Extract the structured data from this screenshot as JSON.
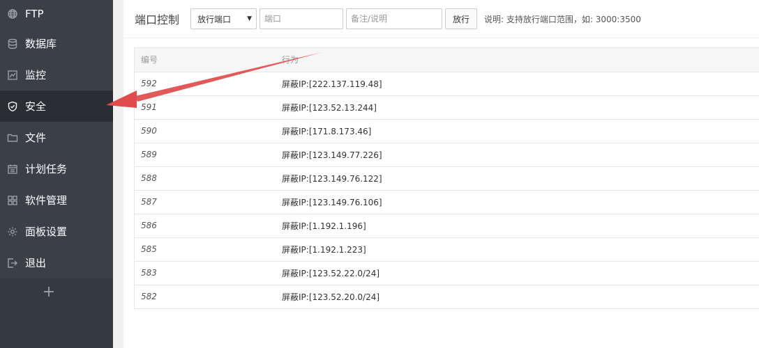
{
  "sidebar": {
    "items": [
      {
        "label": "FTP",
        "icon": "globe-icon",
        "active": false
      },
      {
        "label": "数据库",
        "icon": "database-icon",
        "active": false
      },
      {
        "label": "监控",
        "icon": "monitor-icon",
        "active": false
      },
      {
        "label": "安全",
        "icon": "shield-icon",
        "active": true
      },
      {
        "label": "文件",
        "icon": "folder-icon",
        "active": false
      },
      {
        "label": "计划任务",
        "icon": "calendar-icon",
        "active": false
      },
      {
        "label": "软件管理",
        "icon": "grid-icon",
        "active": false
      },
      {
        "label": "面板设置",
        "icon": "gear-icon",
        "active": false
      },
      {
        "label": "退出",
        "icon": "logout-icon",
        "active": false
      }
    ],
    "add_label": "+"
  },
  "toolbar": {
    "title": "端口控制",
    "select_value": "放行端口",
    "port_placeholder": "端口",
    "note_placeholder": "备注/说明",
    "submit_label": "放行",
    "hint": "说明: 支持放行端口范围，如: 3000:3500"
  },
  "table": {
    "headers": [
      "编号",
      "行为"
    ],
    "rows": [
      {
        "id": "592",
        "action": "屏蔽IP:[222.137.119.48]"
      },
      {
        "id": "591",
        "action": "屏蔽IP:[123.52.13.244]"
      },
      {
        "id": "590",
        "action": "屏蔽IP:[171.8.173.46]"
      },
      {
        "id": "589",
        "action": "屏蔽IP:[123.149.77.226]"
      },
      {
        "id": "588",
        "action": "屏蔽IP:[123.149.76.122]"
      },
      {
        "id": "587",
        "action": "屏蔽IP:[123.149.76.106]"
      },
      {
        "id": "586",
        "action": "屏蔽IP:[1.192.1.196]"
      },
      {
        "id": "585",
        "action": "屏蔽IP:[1.192.1.223]"
      },
      {
        "id": "583",
        "action": "屏蔽IP:[123.52.22.0/24]"
      },
      {
        "id": "582",
        "action": "屏蔽IP:[123.52.20.0/24]"
      }
    ]
  },
  "colors": {
    "sidebar_bg": "#3b3f47",
    "sidebar_active": "#2a2d33",
    "arrow": "#e04b4b"
  }
}
